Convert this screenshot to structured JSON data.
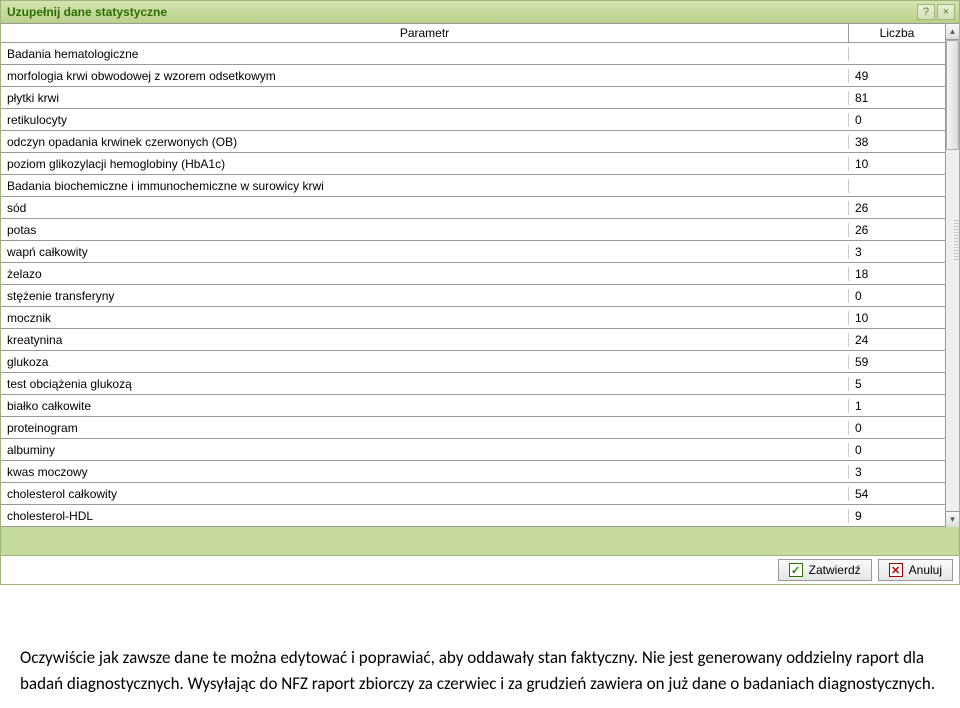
{
  "window": {
    "title": "Uzupełnij dane statystyczne",
    "help_tooltip": "?",
    "close_tooltip": "×"
  },
  "grid": {
    "columns": {
      "param": "Parametr",
      "liczba": "Liczba"
    },
    "rows": [
      {
        "param": "Badania hematologiczne",
        "liczba": ""
      },
      {
        "param": "morfologia krwi obwodowej z wzorem odsetkowym",
        "liczba": "49"
      },
      {
        "param": "płytki krwi",
        "liczba": "81"
      },
      {
        "param": "retikulocyty",
        "liczba": "0"
      },
      {
        "param": "odczyn opadania krwinek czerwonych (OB)",
        "liczba": "38"
      },
      {
        "param": "poziom glikozylacji hemoglobiny (HbA1c)",
        "liczba": "10"
      },
      {
        "param": "Badania biochemiczne i immunochemiczne w surowicy krwi",
        "liczba": ""
      },
      {
        "param": "sód",
        "liczba": "26"
      },
      {
        "param": "potas",
        "liczba": "26"
      },
      {
        "param": "wapń całkowity",
        "liczba": "3"
      },
      {
        "param": "żelazo",
        "liczba": "18"
      },
      {
        "param": "stężenie transferyny",
        "liczba": "0"
      },
      {
        "param": "mocznik",
        "liczba": "10"
      },
      {
        "param": "kreatynina",
        "liczba": "24"
      },
      {
        "param": "glukoza",
        "liczba": "59"
      },
      {
        "param": "test obciążenia glukozą",
        "liczba": "5"
      },
      {
        "param": "białko całkowite",
        "liczba": "1"
      },
      {
        "param": "proteinogram",
        "liczba": "0"
      },
      {
        "param": "albuminy",
        "liczba": "0"
      },
      {
        "param": "kwas moczowy",
        "liczba": "3"
      },
      {
        "param": "cholesterol całkowity",
        "liczba": "54"
      },
      {
        "param": "cholesterol-HDL",
        "liczba": "9"
      }
    ]
  },
  "footer": {
    "confirm_label": "Zatwierdź",
    "cancel_label": "Anuluj"
  },
  "doc": {
    "paragraph": "Oczywiście jak zawsze dane te można edytować i poprawiać, aby oddawały stan faktyczny. Nie jest generowany oddzielny raport dla badań diagnostycznych. Wysyłając do NFZ raport zbiorczy za czerwiec i za grudzień zawiera on już dane o badaniach diagnostycznych."
  }
}
